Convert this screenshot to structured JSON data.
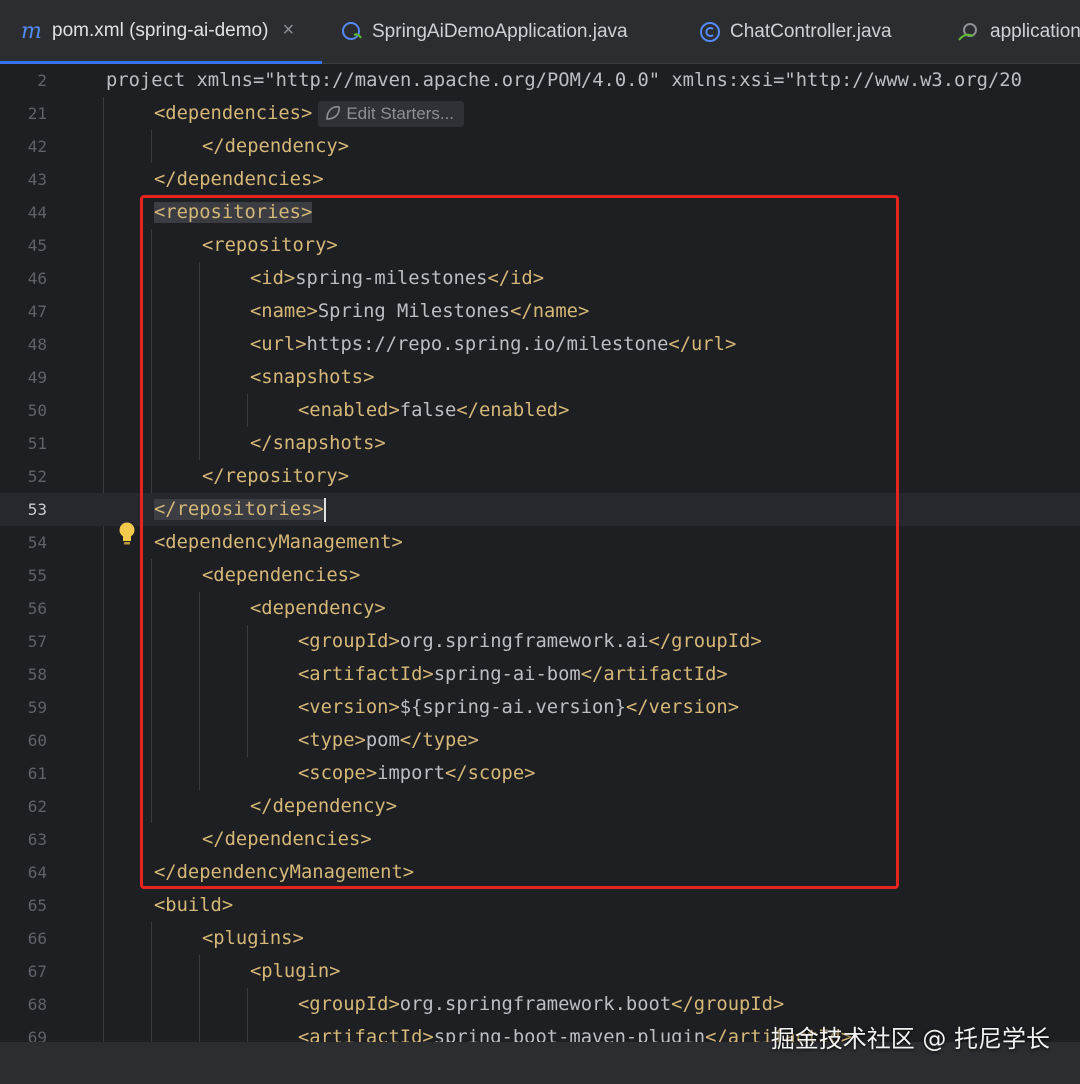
{
  "tabs": [
    {
      "label": "pom.xml (spring-ai-demo)",
      "icon": "maven-m-icon",
      "active": true
    },
    {
      "label": "SpringAiDemoApplication.java",
      "icon": "spring-boot-class-icon",
      "active": false
    },
    {
      "label": "ChatController.java",
      "icon": "class-c-icon",
      "active": false
    },
    {
      "label": "application",
      "icon": "spring-config-icon",
      "active": false
    }
  ],
  "tab_close_symbol": "×",
  "editor": {
    "inlay_hint": "Edit Starters...",
    "current_line": "53",
    "lines": [
      {
        "n": "2",
        "code": "<project xmlns=\"http://maven.apache.org/POM/4.0.0\" xmlns:xsi=\"http://www.w3.org/20"
      },
      {
        "n": "21",
        "code": "<dependencies>"
      },
      {
        "n": "42",
        "code": "</dependency>"
      },
      {
        "n": "43",
        "code": "</dependencies>"
      },
      {
        "n": "44",
        "code": "<repositories>"
      },
      {
        "n": "45",
        "code": "<repository>"
      },
      {
        "n": "46",
        "code": "<id>spring-milestones</id>"
      },
      {
        "n": "47",
        "code": "<name>Spring Milestones</name>"
      },
      {
        "n": "48",
        "code": "<url>https://repo.spring.io/milestone</url>"
      },
      {
        "n": "49",
        "code": "<snapshots>"
      },
      {
        "n": "50",
        "code": "<enabled>false</enabled>"
      },
      {
        "n": "51",
        "code": "</snapshots>"
      },
      {
        "n": "52",
        "code": "</repository>"
      },
      {
        "n": "53",
        "code": "</repositories>"
      },
      {
        "n": "54",
        "code": "<dependencyManagement>"
      },
      {
        "n": "55",
        "code": "<dependencies>"
      },
      {
        "n": "56",
        "code": "<dependency>"
      },
      {
        "n": "57",
        "code": "<groupId>org.springframework.ai</groupId>"
      },
      {
        "n": "58",
        "code": "<artifactId>spring-ai-bom</artifactId>"
      },
      {
        "n": "59",
        "code": "<version>${spring-ai.version}</version>"
      },
      {
        "n": "60",
        "code": "<type>pom</type>"
      },
      {
        "n": "61",
        "code": "<scope>import</scope>"
      },
      {
        "n": "62",
        "code": "</dependency>"
      },
      {
        "n": "63",
        "code": "</dependencies>"
      },
      {
        "n": "64",
        "code": "</dependencyManagement>"
      },
      {
        "n": "65",
        "code": "<build>"
      },
      {
        "n": "66",
        "code": "<plugins>"
      },
      {
        "n": "67",
        "code": "<plugin>"
      },
      {
        "n": "68",
        "code": "<groupId>org.springframework.boot</groupId>"
      },
      {
        "n": "69",
        "code": "<artifactId>spring-boot-maven-plugin</artifactId>"
      }
    ]
  },
  "gutter_icons": {
    "bulb": "lightbulb-icon",
    "override": "implemented-method-icon"
  },
  "highlight_color": "#e5231f",
  "watermark": "掘金技术社区 @ 托尼学长"
}
